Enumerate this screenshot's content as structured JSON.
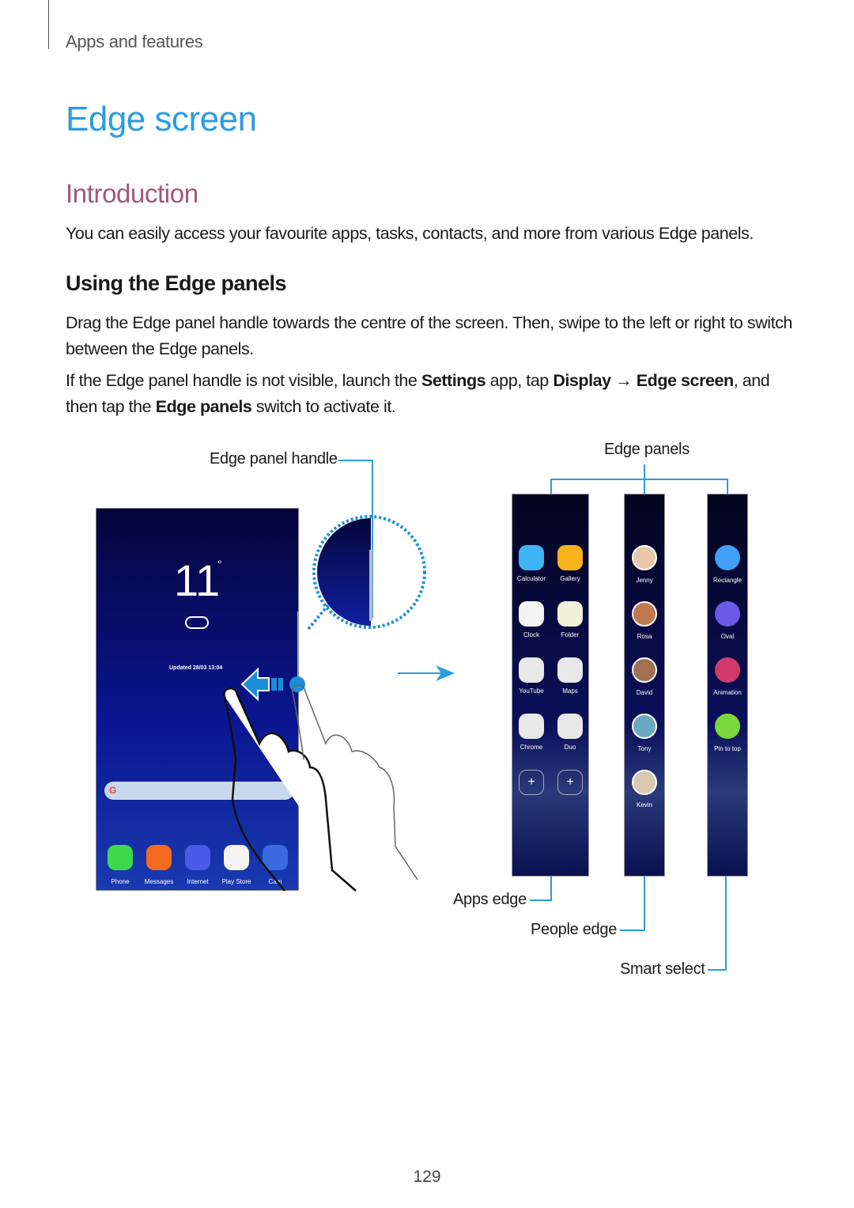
{
  "header": {
    "section": "Apps and features"
  },
  "title": "Edge screen",
  "introduction": {
    "heading": "Introduction",
    "text": "You can easily access your favourite apps, tasks, contacts, and more from various Edge panels."
  },
  "using": {
    "heading": "Using the Edge panels",
    "p1": "Drag the Edge panel handle towards the centre of the screen. Then, swipe to the left or right to switch between the Edge panels.",
    "p2_parts": [
      "If the Edge panel handle is not visible, launch the ",
      "Settings",
      " app, tap ",
      "Display",
      " → ",
      "Edge screen",
      ", and then tap the ",
      "Edge panels",
      " switch to activate it."
    ]
  },
  "figure": {
    "label_handle": "Edge panel handle",
    "label_panels": "Edge panels",
    "label_apps": "Apps edge",
    "label_people": "People edge",
    "label_smart": "Smart select",
    "phone": {
      "temperature": "11",
      "degree": "°",
      "updated": "Updated 28/03 13:04",
      "dock": [
        {
          "label": "Phone",
          "color": "#3dd94a"
        },
        {
          "label": "Messages",
          "color": "#f46a1e"
        },
        {
          "label": "Internet",
          "color": "#4a5ae8"
        },
        {
          "label": "Play Store",
          "color": "#f4f4f4"
        },
        {
          "label": "Cam",
          "color": "#3a6ae0"
        }
      ],
      "search_icon": "google-g-icon"
    },
    "apps_edge": [
      {
        "label": "Calculator",
        "color": "#3fb4f5"
      },
      {
        "label": "Gallery",
        "color": "#f7b21c"
      },
      {
        "label": "Clock",
        "color": "#f4f4f4"
      },
      {
        "label": "Folder",
        "color": "#eef0d8"
      },
      {
        "label": "YouTube",
        "color": "#e8e8e8"
      },
      {
        "label": "Maps",
        "color": "#e8e8e8"
      },
      {
        "label": "Chrome",
        "color": "#e8e8e8"
      },
      {
        "label": "Duo",
        "color": "#e8e8e8"
      }
    ],
    "add_symbol": "+",
    "people_edge": [
      {
        "label": "Jenny",
        "color": "#e8c8a8"
      },
      {
        "label": "Rosa",
        "color": "#c07850"
      },
      {
        "label": "David",
        "color": "#a07050"
      },
      {
        "label": "Tony",
        "color": "#6aaac0"
      },
      {
        "label": "Kevin",
        "color": "#d8c8b0"
      }
    ],
    "smart_select": [
      {
        "label": "Rectangle",
        "color": "#3fa0f5"
      },
      {
        "label": "Oval",
        "color": "#6a5ae8"
      },
      {
        "label": "Animation",
        "color": "#d03a6a"
      },
      {
        "label": "Pin to top",
        "color": "#7ad83a"
      }
    ]
  },
  "page_number": "129",
  "colors": {
    "accent": "#2b9be3",
    "intro": "#a4557a"
  }
}
